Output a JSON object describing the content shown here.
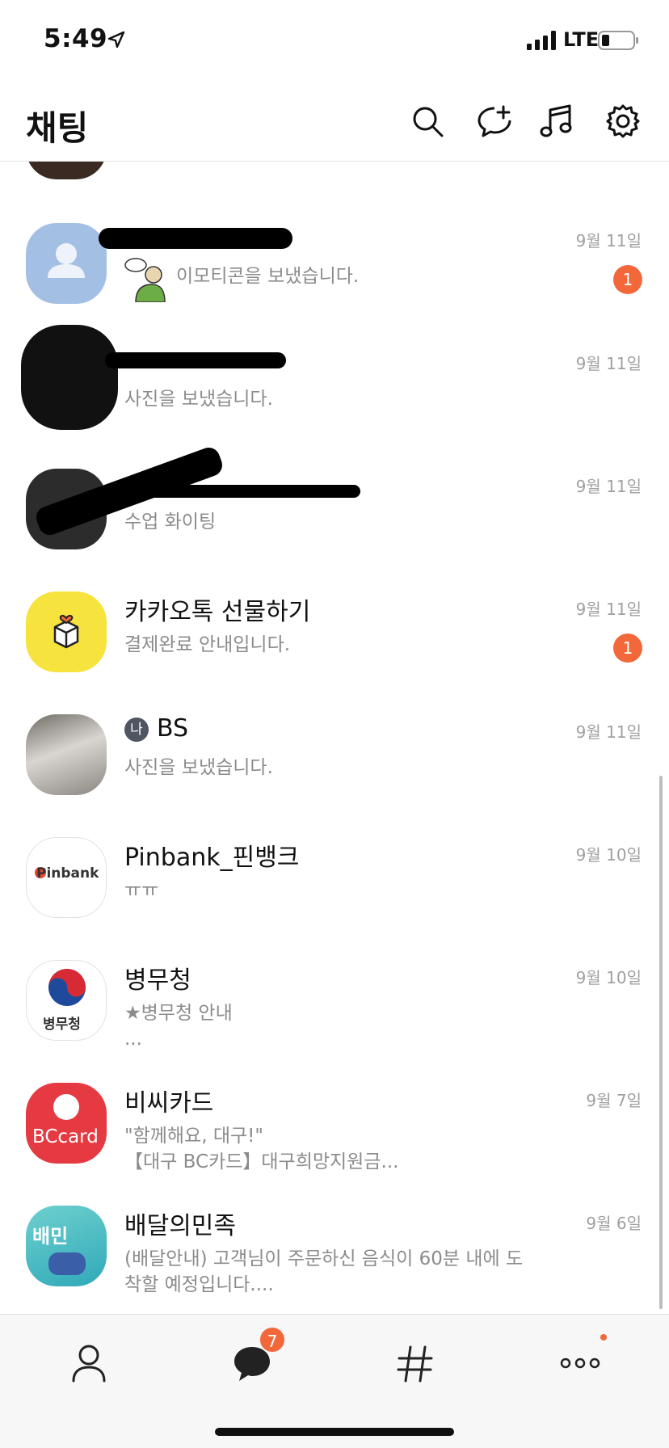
{
  "status_bar": {
    "time": "5:49",
    "network": "LTE"
  },
  "header": {
    "title": "채팅",
    "icons": [
      "search-icon",
      "new-chat-icon",
      "music-icon",
      "settings-icon"
    ]
  },
  "chats": [
    {
      "name": "",
      "message": "",
      "date": "",
      "unread": ""
    },
    {
      "name": "",
      "message": "이모티콘을 보냈습니다.",
      "date": "9월 11일",
      "unread": "1"
    },
    {
      "name": "",
      "message": "사진을 보냈습니다.",
      "date": "9월 11일",
      "unread": ""
    },
    {
      "name": "",
      "message": "수업 화이팅",
      "date": "9월 11일",
      "unread": ""
    },
    {
      "name": "카카오톡 선물하기",
      "message": "결제완료 안내입니다.",
      "date": "9월 11일",
      "unread": "1"
    },
    {
      "name": "BS",
      "me_badge": "나",
      "message": "사진을 보냈습니다.",
      "date": "9월 11일",
      "unread": ""
    },
    {
      "name": "Pinbank_핀뱅크",
      "message": "ㅠㅠ",
      "date": "9월 10일",
      "unread": "",
      "avatar_text": "Pinbank"
    },
    {
      "name": "병무청",
      "message": "★병무청 안내",
      "message2": "...",
      "date": "9월 10일",
      "unread": "",
      "avatar_text": "병무청"
    },
    {
      "name": "비씨카드",
      "message": "\"함께해요, 대구!\"",
      "message2": "【대구 BC카드】대구희망지원금...",
      "date": "9월 7일",
      "unread": "",
      "avatar_text": "BCcard"
    },
    {
      "name": "배달의민족",
      "message": "(배달안내) 고객님이 주문하신 음식이 60분 내에 도",
      "message2": "착할 예정입니다....",
      "date": "9월 6일",
      "unread": "",
      "avatar_text": "배민"
    }
  ],
  "tab_bar": {
    "chat_badge": "7",
    "tabs": [
      "friends-tab",
      "chats-tab",
      "openchat-tab",
      "more-tab"
    ]
  },
  "colors": {
    "badge": "#f2683a",
    "gift_yellow": "#f7e33d",
    "bc_red": "#e63a43"
  }
}
